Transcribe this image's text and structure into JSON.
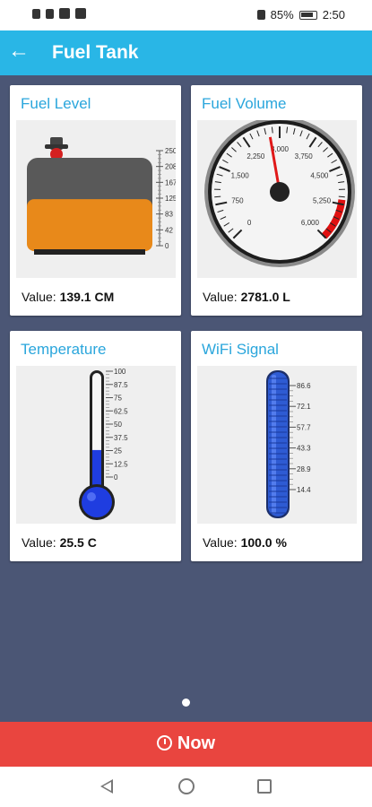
{
  "status_bar": {
    "battery": "85%",
    "time": "2:50"
  },
  "app_bar": {
    "title": "Fuel Tank"
  },
  "cards": [
    {
      "title": "Fuel Level",
      "value_label": "Value:",
      "value": "139.1 CM",
      "ticks": [
        "250",
        "208",
        "167",
        "125",
        "83",
        "42",
        "0"
      ],
      "level": 0.556
    },
    {
      "title": "Fuel Volume",
      "value_label": "Value:",
      "value": "2781.0 L",
      "ticks": [
        "0",
        "750",
        "1,500",
        "2,250",
        "3,000",
        "3,750",
        "4,500",
        "5,250",
        "6,000"
      ],
      "max": 6000
    },
    {
      "title": "Temperature",
      "value_label": "Value:",
      "value": "25.5 C",
      "ticks": [
        "100",
        "87.5",
        "75",
        "62.5",
        "50",
        "37.5",
        "25",
        "12.5",
        "0"
      ],
      "level": 0.255
    },
    {
      "title": "WiFi Signal",
      "value_label": "Value:",
      "value": "100.0 %",
      "ticks": [
        "86.6",
        "72.1",
        "57.7",
        "43.3",
        "28.9",
        "14.4"
      ],
      "level": 1.0
    }
  ],
  "bottom_button": {
    "label": "Now"
  },
  "colors": {
    "accent": "#29b6e6",
    "title": "#2aa6dc",
    "fuel": "#e8891a",
    "now": "#e9453f",
    "thermo": "#1f3de0",
    "wifi": "#2e5bd3",
    "background": "#4b5675"
  }
}
